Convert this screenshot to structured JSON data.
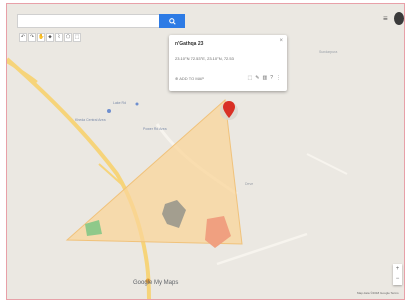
{
  "search": {
    "button_icon": "search-icon"
  },
  "toolbar": {
    "tools": [
      "↶",
      "↷",
      "✋",
      "⬥",
      "⌇",
      "⬠",
      "⬚"
    ]
  },
  "popup": {
    "title": "n'Gathqa 23",
    "coords": "23.10°N 72.53°E, 23.10°N, 72.53",
    "action": "⊕  ADD TO MAP",
    "close": "×",
    "icons": [
      "⬚",
      "✎",
      "▥",
      "?",
      "⋮"
    ]
  },
  "map_labels": {
    "poi1": "Lake Rd",
    "poi2": "Kheda Central Area",
    "poi3": "Power Rd Area",
    "area_ne": "Sundarpura",
    "place_east": "Deve"
  },
  "controls": {
    "zoom_in": "+",
    "zoom_out": "−",
    "menu": "≡"
  },
  "footer": {
    "google": "Google My Maps",
    "attribution": "Map data ©2018 Google   Terms"
  },
  "colors": {
    "map_bg": "#ebe8e2",
    "road_yellow": "#f6d47a",
    "polygon_fill": "#f9d69a",
    "polygon_green": "#8fc98a",
    "polygon_gray": "#a39e8f",
    "polygon_orange": "#f0a080",
    "marker_red": "#d93025",
    "search_button": "#2d7be5"
  }
}
